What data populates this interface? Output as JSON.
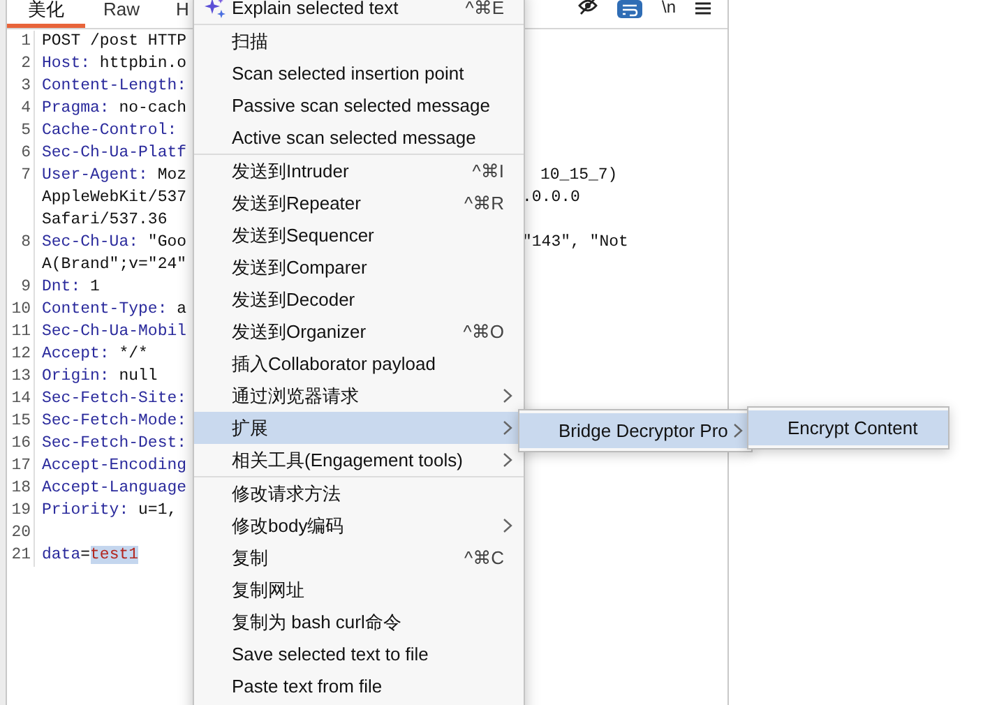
{
  "editor": {
    "tabs": [
      {
        "label": "美化",
        "selected": true
      },
      {
        "label": "Raw",
        "selected": false
      },
      {
        "label": "H",
        "selected": false
      }
    ],
    "toolbar": [
      {
        "kind": "hide"
      },
      {
        "kind": "wrap",
        "on": true
      },
      {
        "kind": "text",
        "label": "\\n"
      },
      {
        "kind": "menu"
      }
    ],
    "lines": [
      {
        "number": "1",
        "rows": [
          {
            "left": [
              {
                "text": "POST /post HTTP",
                "kind": "plain",
                "selected": false
              }
            ]
          }
        ]
      },
      {
        "number": "2",
        "rows": [
          {
            "left": [
              {
                "text": "Host:",
                "kind": "header",
                "selected": false
              },
              {
                "text": " httpbin.o",
                "kind": "plain",
                "selected": false
              }
            ]
          }
        ]
      },
      {
        "number": "3",
        "rows": [
          {
            "left": [
              {
                "text": "Content-Length:",
                "kind": "header",
                "selected": false
              }
            ]
          }
        ]
      },
      {
        "number": "4",
        "rows": [
          {
            "left": [
              {
                "text": "Pragma:",
                "kind": "header",
                "selected": false
              },
              {
                "text": " no-cach",
                "kind": "plain",
                "selected": false
              }
            ]
          }
        ]
      },
      {
        "number": "5",
        "rows": [
          {
            "left": [
              {
                "text": "Cache-Control:",
                "kind": "header",
                "selected": false
              }
            ]
          }
        ]
      },
      {
        "number": "6",
        "rows": [
          {
            "left": [
              {
                "text": "Sec-Ch-Ua-Platf",
                "kind": "header",
                "selected": false
              }
            ]
          }
        ]
      },
      {
        "number": "7",
        "rows": [
          {
            "left": [
              {
                "text": "User-Agent:",
                "kind": "header",
                "selected": false
              },
              {
                "text": " Moz",
                "kind": "plain",
                "selected": false
              }
            ],
            "right": "10_15_7)"
          },
          {
            "left": [
              {
                "text": "AppleWebKit/537",
                "kind": "plain",
                "selected": false
              }
            ],
            "right": ".0.0.0"
          },
          {
            "left": [
              {
                "text": "Safari/537.36",
                "kind": "plain",
                "selected": false
              }
            ]
          }
        ]
      },
      {
        "number": "8",
        "rows": [
          {
            "left": [
              {
                "text": "Sec-Ch-Ua:",
                "kind": "header",
                "selected": false
              },
              {
                "text": " \"Goo",
                "kind": "plain",
                "selected": false
              }
            ],
            "right": "\"143\", \"Not"
          },
          {
            "left": [
              {
                "text": "A(Brand\";v=\"24\"",
                "kind": "plain",
                "selected": false
              }
            ]
          }
        ]
      },
      {
        "number": "9",
        "rows": [
          {
            "left": [
              {
                "text": "Dnt:",
                "kind": "header",
                "selected": false
              },
              {
                "text": " 1",
                "kind": "plain",
                "selected": false
              }
            ]
          }
        ]
      },
      {
        "number": "10",
        "rows": [
          {
            "left": [
              {
                "text": "Content-Type:",
                "kind": "header",
                "selected": false
              },
              {
                "text": " a",
                "kind": "plain",
                "selected": false
              }
            ]
          }
        ]
      },
      {
        "number": "11",
        "rows": [
          {
            "left": [
              {
                "text": "Sec-Ch-Ua-Mobil",
                "kind": "header",
                "selected": false
              }
            ]
          }
        ]
      },
      {
        "number": "12",
        "rows": [
          {
            "left": [
              {
                "text": "Accept:",
                "kind": "header",
                "selected": false
              },
              {
                "text": " */*",
                "kind": "plain",
                "selected": false
              }
            ]
          }
        ]
      },
      {
        "number": "13",
        "rows": [
          {
            "left": [
              {
                "text": "Origin:",
                "kind": "header",
                "selected": false
              },
              {
                "text": " null",
                "kind": "plain",
                "selected": false
              }
            ]
          }
        ]
      },
      {
        "number": "14",
        "rows": [
          {
            "left": [
              {
                "text": "Sec-Fetch-Site:",
                "kind": "header",
                "selected": false
              }
            ]
          }
        ]
      },
      {
        "number": "15",
        "rows": [
          {
            "left": [
              {
                "text": "Sec-Fetch-Mode:",
                "kind": "header",
                "selected": false
              }
            ]
          }
        ]
      },
      {
        "number": "16",
        "rows": [
          {
            "left": [
              {
                "text": "Sec-Fetch-Dest:",
                "kind": "header",
                "selected": false
              }
            ]
          }
        ]
      },
      {
        "number": "17",
        "rows": [
          {
            "left": [
              {
                "text": "Accept-Encoding",
                "kind": "header",
                "selected": false
              }
            ]
          }
        ]
      },
      {
        "number": "18",
        "rows": [
          {
            "left": [
              {
                "text": "Accept-Language",
                "kind": "header",
                "selected": false
              }
            ]
          }
        ]
      },
      {
        "number": "19",
        "rows": [
          {
            "left": [
              {
                "text": "Priority:",
                "kind": "header",
                "selected": false
              },
              {
                "text": " u=1,",
                "kind": "plain",
                "selected": false
              }
            ]
          }
        ]
      },
      {
        "number": "20",
        "rows": [
          {
            "left": []
          }
        ]
      },
      {
        "number": "21",
        "rows": [
          {
            "left": [
              {
                "text": "data",
                "kind": "param",
                "selected": false
              },
              {
                "text": "=",
                "kind": "plain",
                "selected": false
              },
              {
                "text": "test1",
                "kind": "value",
                "selected": true
              }
            ]
          }
        ]
      }
    ]
  },
  "context_menu": {
    "items": [
      {
        "kind": "ai",
        "label": "Explain selected text",
        "shortcut": "^⌘E",
        "selected": false
      },
      {
        "kind": "separator"
      },
      {
        "kind": "item",
        "label": "扫描",
        "selected": false
      },
      {
        "kind": "item",
        "label": "Scan selected insertion point",
        "selected": false
      },
      {
        "kind": "item",
        "label": "Passive scan selected message",
        "selected": false
      },
      {
        "kind": "item",
        "label": "Active scan selected message",
        "selected": false
      },
      {
        "kind": "separator"
      },
      {
        "kind": "item",
        "label": "发送到Intruder",
        "shortcut": "^⌘I",
        "selected": false
      },
      {
        "kind": "item",
        "label": "发送到Repeater",
        "shortcut": "^⌘R",
        "selected": false
      },
      {
        "kind": "item",
        "label": "发送到Sequencer",
        "selected": false
      },
      {
        "kind": "item",
        "label": "发送到Comparer",
        "selected": false
      },
      {
        "kind": "item",
        "label": "发送到Decoder",
        "selected": false
      },
      {
        "kind": "item",
        "label": "发送到Organizer",
        "shortcut": "^⌘O",
        "selected": false
      },
      {
        "kind": "item",
        "label": "插入Collaborator payload",
        "selected": false
      },
      {
        "kind": "item",
        "label": "通过浏览器请求",
        "submenu": true,
        "selected": false
      },
      {
        "kind": "item",
        "label": "扩展",
        "submenu": true,
        "selected": true,
        "children": [
          {
            "label": "Bridge Decryptor Pro",
            "submenu": true,
            "selected": true,
            "children": [
              {
                "label": "Encrypt Content",
                "selected": true
              }
            ]
          }
        ]
      },
      {
        "kind": "item",
        "label": "相关工具(Engagement tools)",
        "submenu": true,
        "selected": false
      },
      {
        "kind": "separator"
      },
      {
        "kind": "item",
        "label": "修改请求方法",
        "selected": false
      },
      {
        "kind": "item",
        "label": "修改body编码",
        "submenu": true,
        "selected": false
      },
      {
        "kind": "item",
        "label": "复制",
        "shortcut": "^⌘C",
        "selected": false
      },
      {
        "kind": "item",
        "label": "复制网址",
        "selected": false
      },
      {
        "kind": "item",
        "label": "复制为 bash curl命令",
        "selected": false
      },
      {
        "kind": "item",
        "label": "Save selected text to file",
        "selected": false
      },
      {
        "kind": "item",
        "label": "Paste text from file",
        "selected": false
      }
    ]
  }
}
